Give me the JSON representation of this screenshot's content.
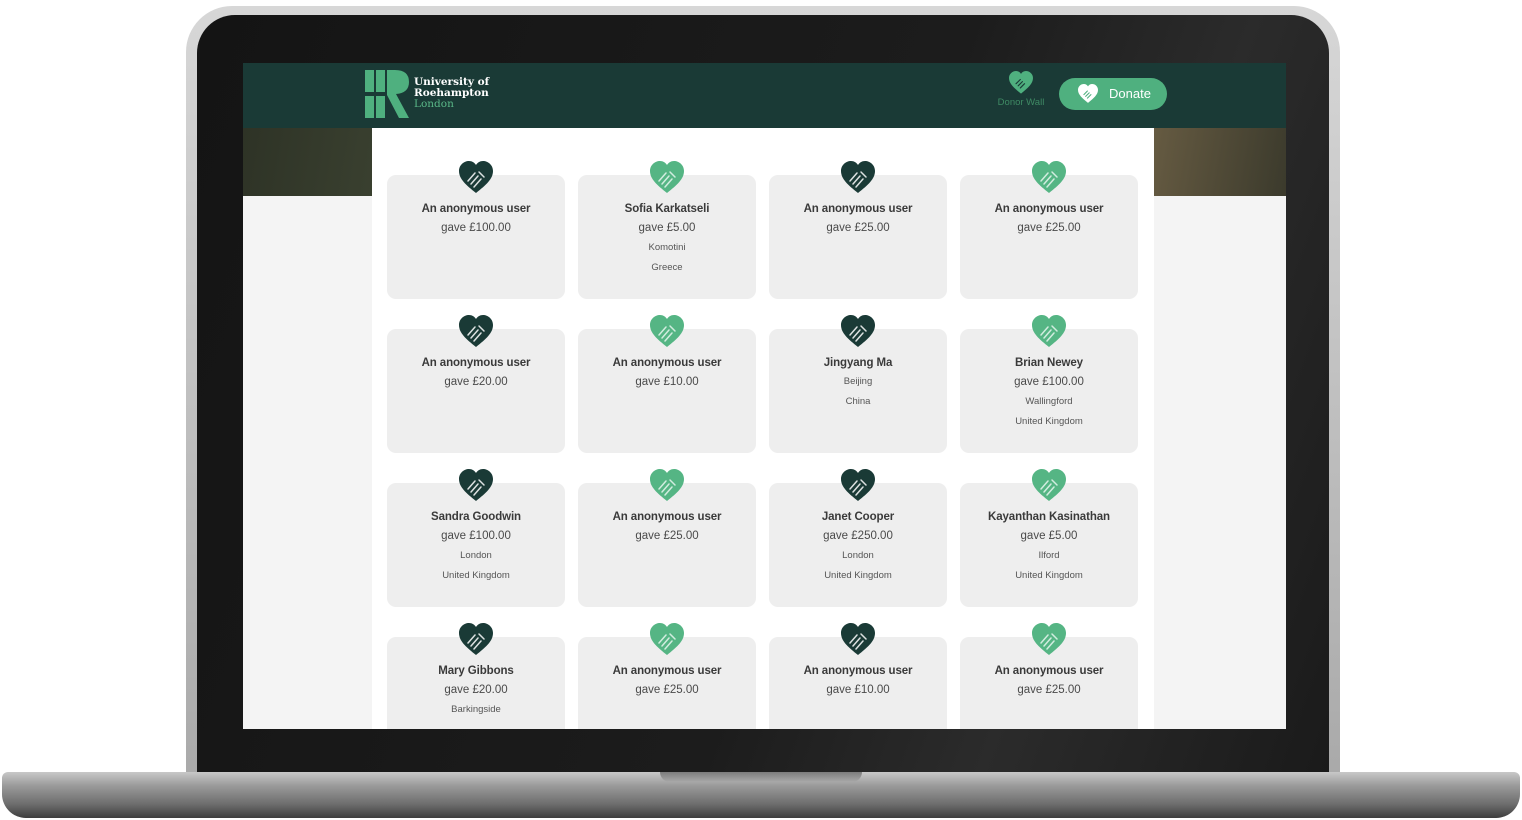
{
  "header": {
    "logo_line1": "University of",
    "logo_line2": "Roehampton",
    "logo_line3": "London",
    "donor_wall_label": "Donor Wall",
    "donate_label": "Donate"
  },
  "colors": {
    "navbar": "#1a3a36",
    "accent_green": "#4fb07f",
    "heart_dark": "#1a3a36",
    "heart_light": "#55b584",
    "card_bg": "#eeeeee"
  },
  "donors": [
    {
      "name": "An anonymous user",
      "amount": "gave £100.00",
      "city": "",
      "country": "",
      "heart": "dark-heart-icon"
    },
    {
      "name": "Sofia Karkatseli",
      "amount": "gave £5.00",
      "city": "Komotini",
      "country": "Greece",
      "heart": "light-heart-icon"
    },
    {
      "name": "An anonymous user",
      "amount": "gave £25.00",
      "city": "",
      "country": "",
      "heart": "dark-heart-icon"
    },
    {
      "name": "An anonymous user",
      "amount": "gave £25.00",
      "city": "",
      "country": "",
      "heart": "light-heart-icon"
    },
    {
      "name": "An anonymous user",
      "amount": "gave £20.00",
      "city": "",
      "country": "",
      "heart": "dark-heart-icon"
    },
    {
      "name": "An anonymous user",
      "amount": "gave £10.00",
      "city": "",
      "country": "",
      "heart": "light-heart-icon"
    },
    {
      "name": "Jingyang Ma",
      "amount": "",
      "city": "Beijing",
      "country": "China",
      "heart": "dark-heart-icon"
    },
    {
      "name": "Brian Newey",
      "amount": "gave £100.00",
      "city": "Wallingford",
      "country": "United Kingdom",
      "heart": "light-heart-icon"
    },
    {
      "name": "Sandra Goodwin",
      "amount": "gave £100.00",
      "city": "London",
      "country": "United Kingdom",
      "heart": "dark-heart-icon"
    },
    {
      "name": "An anonymous user",
      "amount": "gave £25.00",
      "city": "",
      "country": "",
      "heart": "light-heart-icon"
    },
    {
      "name": "Janet Cooper",
      "amount": "gave £250.00",
      "city": "London",
      "country": "United Kingdom",
      "heart": "dark-heart-icon"
    },
    {
      "name": "Kayanthan Kasinathan",
      "amount": "gave £5.00",
      "city": "Ilford",
      "country": "United Kingdom",
      "heart": "light-heart-icon"
    },
    {
      "name": "Mary Gibbons",
      "amount": "gave £20.00",
      "city": "Barkingside",
      "country": "",
      "heart": "dark-heart-icon"
    },
    {
      "name": "An anonymous user",
      "amount": "gave £25.00",
      "city": "",
      "country": "",
      "heart": "light-heart-icon"
    },
    {
      "name": "An anonymous user",
      "amount": "gave £10.00",
      "city": "",
      "country": "",
      "heart": "dark-heart-icon"
    },
    {
      "name": "An anonymous user",
      "amount": "gave £25.00",
      "city": "",
      "country": "",
      "heart": "light-heart-icon"
    }
  ]
}
